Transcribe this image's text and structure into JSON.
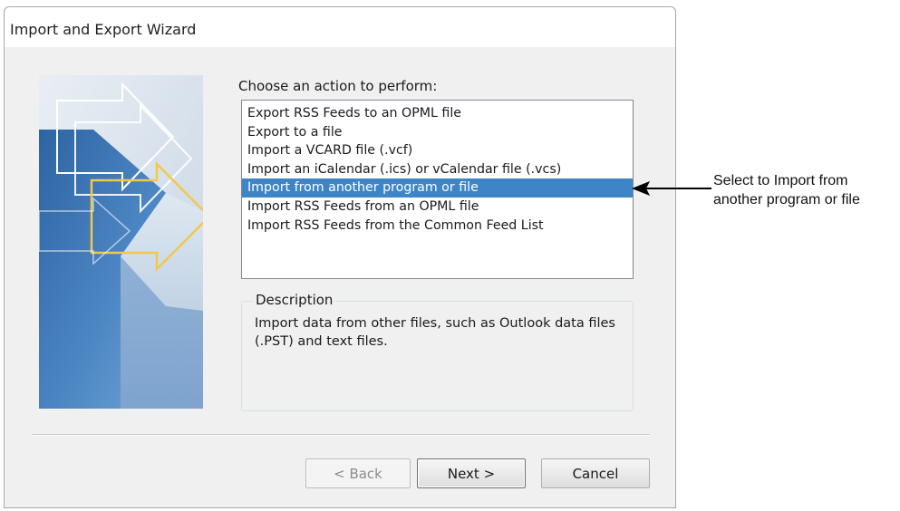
{
  "dialog": {
    "title": "Import and Export Wizard",
    "action_label": "Choose an action to perform:",
    "actions": [
      "Export RSS Feeds to an OPML file",
      "Export to a file",
      "Import a VCARD file (.vcf)",
      "Import an iCalendar (.ics) or vCalendar file (.vcs)",
      "Import from another program or file",
      "Import RSS Feeds from an OPML file",
      "Import RSS Feeds from the Common Feed List"
    ],
    "selected_index": 4,
    "description": {
      "legend": "Description",
      "text": "Import data from other files, such as Outlook data files (.PST) and text files."
    },
    "buttons": {
      "back": "< Back",
      "next": "Next >",
      "cancel": "Cancel"
    }
  },
  "annotation": {
    "line1": "Select to Import from",
    "line2": "another program or file"
  },
  "colors": {
    "selection": "#3d85c6",
    "graphic_blue": "#2f6aa8",
    "graphic_arrow_outline": "#ffffff",
    "graphic_arrow_yellow": "#f2c84b"
  }
}
